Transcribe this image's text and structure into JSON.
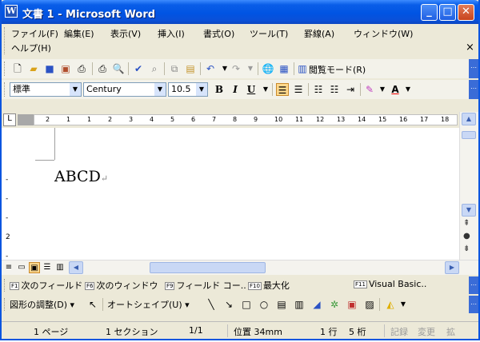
{
  "window": {
    "title": "文書 1 - Microsoft Word",
    "app_icon": "W"
  },
  "title_buttons": {
    "minimize": "_",
    "maximize": "□",
    "close": "✕"
  },
  "menu": {
    "items": [
      "ファイル(F)",
      "編集(E)",
      "表示(V)",
      "挿入(I)",
      "書式(O)",
      "ツール(T)",
      "罫線(A)",
      "ウィンドウ(W)",
      "ヘルプ(H)"
    ],
    "close_glyph": "×"
  },
  "standard_toolbar": {
    "reading_mode_label": "閲覧モード(R)"
  },
  "format_toolbar": {
    "style": "標準",
    "font": "Century",
    "size": "10.5",
    "bold": "B",
    "italic": "I",
    "underline": "U",
    "font_color_label": "A"
  },
  "ruler": {
    "numbers": [
      "2",
      "1",
      "1",
      "2",
      "3",
      "4",
      "5",
      "6",
      "7",
      "8",
      "9",
      "10",
      "11",
      "12",
      "13",
      "14",
      "15",
      "16",
      "17",
      "18"
    ]
  },
  "vruler": {
    "numbers": [
      "-",
      "-",
      "-",
      "2",
      "-"
    ]
  },
  "document": {
    "text": "ABCD",
    "paragraph_mark": "↵"
  },
  "fkeys": [
    {
      "key": "F1",
      "label": "次のフィールド"
    },
    {
      "key": "F6",
      "label": "次のウィンドウ"
    },
    {
      "key": "F9",
      "label": "フィールド コー.."
    },
    {
      "key": "F10",
      "label": "最大化"
    },
    {
      "key": "F11",
      "label": "Visual Basic.."
    }
  ],
  "drawing": {
    "draw_label": "図形の調整(D) ▾",
    "autoshape_label": "オートシェイプ(U) ▾"
  },
  "status": {
    "page": "1 ページ",
    "section": "1 セクション",
    "page_count": "1/1",
    "position": "位置 34mm",
    "line": "1 行",
    "column": "5 桁",
    "rec": "記録",
    "trk": "変更",
    "ext": "拡"
  }
}
